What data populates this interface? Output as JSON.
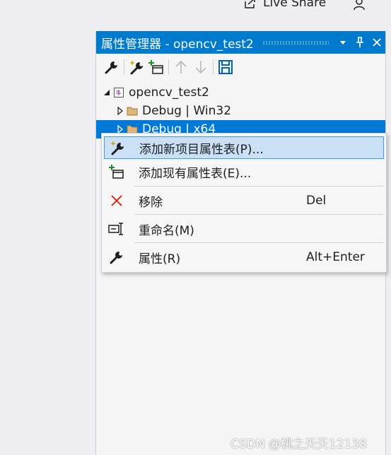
{
  "top_bar": {
    "live_share_label": "Live Share",
    "live_share_icon": "live-share-icon",
    "person_icon": "person-icon"
  },
  "panel": {
    "title": "属性管理器 - opencv_test2",
    "title_buttons": [
      "dropdown-icon",
      "pin-icon",
      "close-icon"
    ],
    "toolbar_icons": [
      "wrench-icon",
      "add-new-property-sheet-icon",
      "add-existing-property-sheet-icon",
      "move-up-icon",
      "move-down-icon",
      "save-icon"
    ]
  },
  "tree": {
    "root": "opencv_test2",
    "items": [
      "Debug | Win32",
      "Debug | x64"
    ]
  },
  "context_menu": {
    "items": [
      {
        "label": "添加新项目属性表(P)...",
        "shortcut": "",
        "icon": "wand-wrench-icon"
      },
      {
        "label": "添加现有属性表(E)...",
        "shortcut": "",
        "icon": "add-existing-icon"
      },
      {
        "label": "移除",
        "shortcut": "Del",
        "icon": "delete-x-icon"
      },
      {
        "label": "重命名(M)",
        "shortcut": "",
        "icon": "rename-icon"
      },
      {
        "label": "属性(R)",
        "shortcut": "Alt+Enter",
        "icon": "wrench-icon"
      }
    ]
  },
  "colors": {
    "accent": "#007acc",
    "selection": "#0078d7",
    "menu_highlight": "#c9e0f7",
    "delete_red": "#e51400"
  },
  "watermark": "CSDN @桃之夭夭12138"
}
